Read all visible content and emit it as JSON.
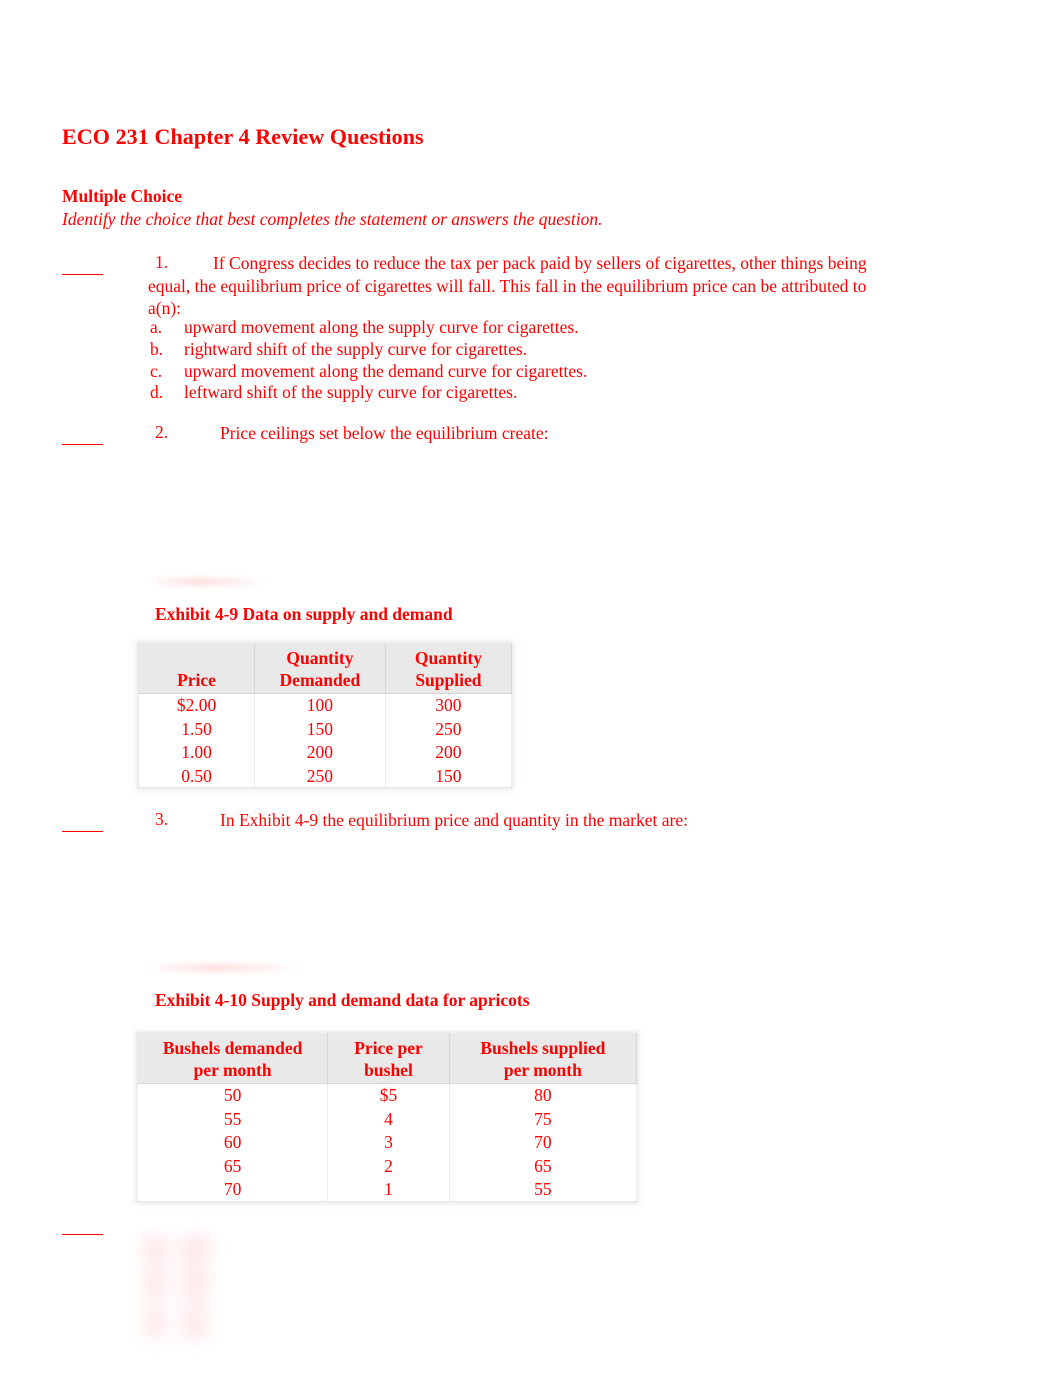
{
  "document": {
    "title": "ECO 231 Chapter 4 Review Questions",
    "section_heading": "Multiple Choice",
    "section_instruction": "Identify the choice that best completes the statement or answers the question."
  },
  "questions": [
    {
      "number": "1.",
      "stem": "If Congress decides to reduce the tax per pack paid by sellers of cigarettes, other things being equal, the equilibrium price of cigarettes will fall. This fall in the equilibrium price can be attributed to a(n):",
      "options": [
        {
          "letter": "a.",
          "text": "upward movement along the supply curve for cigarettes."
        },
        {
          "letter": "b.",
          "text": "rightward shift of the supply curve for cigarettes."
        },
        {
          "letter": "c.",
          "text": "upward movement along the demand curve for cigarettes."
        },
        {
          "letter": "d.",
          "text": "leftward shift of the supply curve for cigarettes."
        }
      ]
    },
    {
      "number": "2.",
      "stem": "Price ceilings set below the equilibrium create:",
      "options": []
    },
    {
      "number": "3.",
      "stem": "In Exhibit 4-9 the equilibrium price and quantity in the market are:",
      "options": []
    }
  ],
  "exhibits": [
    {
      "title": "Exhibit 4-9 Data on supply and demand",
      "headers": [
        "Price",
        "Quantity\nDemanded",
        "Quantity\nSupplied"
      ],
      "header_lines": [
        [
          "",
          "Price"
        ],
        [
          "Quantity",
          "Demanded"
        ],
        [
          "Quantity",
          "Supplied"
        ]
      ],
      "rows": [
        [
          "$2.00",
          "100",
          "300"
        ],
        [
          "1.50",
          "150",
          "250"
        ],
        [
          "1.00",
          "200",
          "200"
        ],
        [
          "0.50",
          "250",
          "150"
        ]
      ]
    },
    {
      "title": "Exhibit 4-10 Supply and demand data for apricots",
      "header_lines": [
        [
          "Bushels demanded",
          "per month"
        ],
        [
          "Price per",
          "bushel"
        ],
        [
          "Bushels supplied",
          "per month"
        ]
      ],
      "rows": [
        [
          "50",
          "$5",
          "80"
        ],
        [
          "55",
          "4",
          "75"
        ],
        [
          "60",
          "3",
          "70"
        ],
        [
          "65",
          "2",
          "65"
        ],
        [
          "70",
          "1",
          "55"
        ]
      ]
    }
  ],
  "colors": {
    "text_red": "#ff0000",
    "table_header_gray": "#e9e9e9",
    "page_background": "#ffffff"
  }
}
